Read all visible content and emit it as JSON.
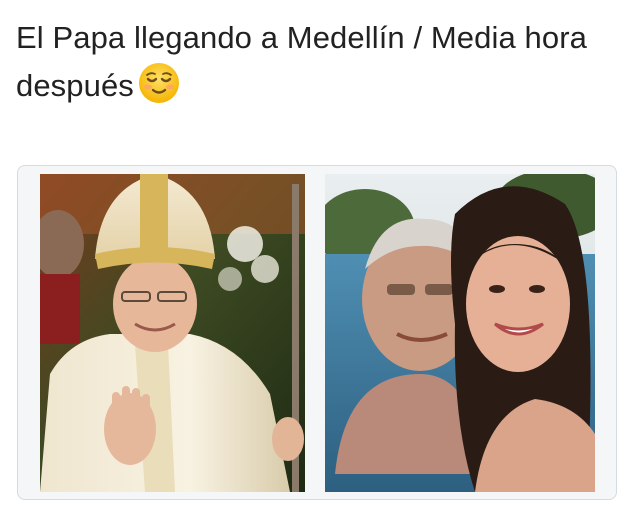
{
  "tweet": {
    "text": "El Papa llegando a Medellín / Media hora después",
    "emoji": "relieved-face-emoji"
  },
  "media": {
    "photos": [
      {
        "name": "pope-ceremony-photo"
      },
      {
        "name": "pool-selfie-photo"
      }
    ]
  },
  "colors": {
    "text": "#222222",
    "card_border": "#d6dbdf",
    "emoji_yellow": "#ffcc33"
  }
}
